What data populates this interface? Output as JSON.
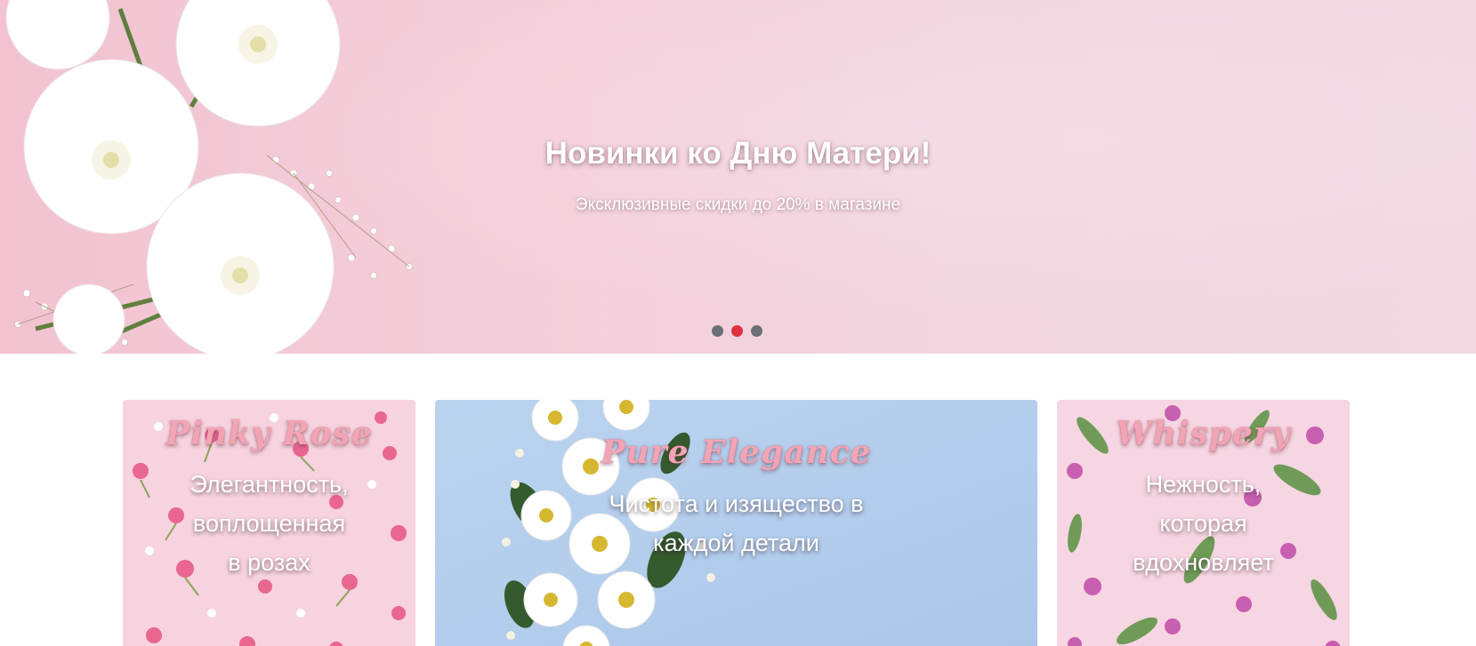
{
  "hero": {
    "title": "Новинки ко Дню Матери!",
    "subtitle": "Эксклюзивные скидки до 20% в магазине",
    "slides": 3,
    "active_slide": 2,
    "colors": {
      "background": "#f2cfdb",
      "dot": "#6b6f76",
      "dot_active": "#e0313f"
    }
  },
  "cards": [
    {
      "title": "Pinky Rose",
      "lines": [
        "Элегантность,",
        "воплощенная",
        "в розах"
      ]
    },
    {
      "title": "Pure Elegance",
      "lines": [
        "Чистота и изящество в",
        "каждой детали"
      ]
    },
    {
      "title": "Whispery",
      "lines": [
        "Нежность,",
        "которая",
        "вдохновляет"
      ]
    }
  ],
  "colors": {
    "title_pink": "#f3a4b4",
    "pure_bg": "#b3cdec",
    "pinky_bg": "#f6d3df"
  }
}
